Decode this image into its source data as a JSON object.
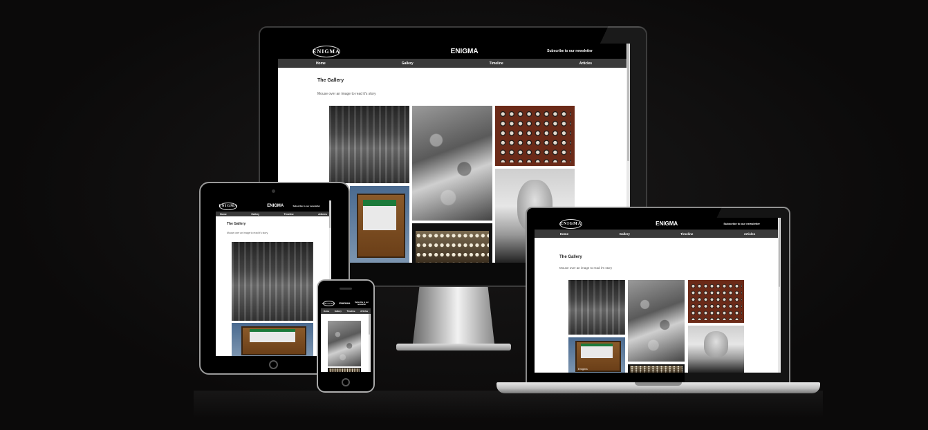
{
  "site": {
    "logo_text": "ENIGMA",
    "title": "ENIGMA",
    "newsletter": "Subscribe to our newsletter",
    "nav": [
      "Home",
      "Gallery",
      "Timeline",
      "Articles"
    ],
    "heading": "The Gallery",
    "subtext": "Mouse over an image to read it's story",
    "photo_caption": "Enigma"
  },
  "devices": [
    "desktop-monitor",
    "laptop",
    "tablet",
    "phone"
  ],
  "colors": {
    "background": "#0d0c0c",
    "site_header": "#000000",
    "site_nav": "#3a3a3a",
    "site_body": "#ffffff"
  },
  "gallery_photos": [
    "forest-truck",
    "crowd-car",
    "bombe-machine",
    "portrait",
    "enigma-machine",
    "enigma-keys"
  ]
}
